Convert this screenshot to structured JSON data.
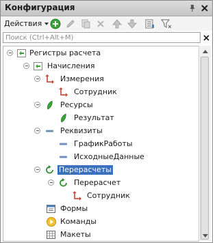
{
  "window": {
    "title": "Конфигурация",
    "pin_icon": "pin-icon",
    "close_icon": "close-icon"
  },
  "toolbar": {
    "actions_label": "Действия",
    "icons": [
      "add-icon",
      "edit-icon",
      "copy-icon",
      "delete-icon",
      "move-up-icon",
      "move-down-icon",
      "list-icon",
      "filter-icon"
    ],
    "accent": "#3aa33a"
  },
  "search": {
    "placeholder": "Поиск (Ctrl+Alt+M)",
    "value": ""
  },
  "tree": {
    "selected_color": "#3c6fbd",
    "items": [
      {
        "label": "Регистры расчета",
        "icon": "calc-register-icon",
        "expanded": true,
        "selected": false
      },
      {
        "label": "Начисления",
        "icon": "calc-register-icon",
        "expanded": true,
        "selected": false
      },
      {
        "label": "Измерения",
        "icon": "dimension-icon",
        "expanded": true,
        "selected": false
      },
      {
        "label": "Сотрудник",
        "icon": "dimension-icon",
        "expanded": false,
        "selected": false
      },
      {
        "label": "Ресурсы",
        "icon": "resource-icon",
        "expanded": true,
        "selected": false
      },
      {
        "label": "Результат",
        "icon": "resource-icon",
        "expanded": false,
        "selected": false
      },
      {
        "label": "Реквизиты",
        "icon": "attribute-icon",
        "expanded": true,
        "selected": false
      },
      {
        "label": "ГрафикРаботы",
        "icon": "attribute-icon",
        "expanded": false,
        "selected": false
      },
      {
        "label": "ИсходныеДанные",
        "icon": "attribute-icon",
        "expanded": false,
        "selected": false
      },
      {
        "label": "Перерасчеты",
        "icon": "recalculation-icon",
        "expanded": true,
        "selected": true
      },
      {
        "label": "Перерасчет",
        "icon": "recalculation-icon",
        "expanded": true,
        "selected": false
      },
      {
        "label": "Сотрудник",
        "icon": "dimension-icon",
        "expanded": false,
        "selected": false
      },
      {
        "label": "Формы",
        "icon": "form-icon",
        "expanded": false,
        "selected": false
      },
      {
        "label": "Команды",
        "icon": "command-icon",
        "expanded": false,
        "selected": false
      },
      {
        "label": "Макеты",
        "icon": "template-icon",
        "expanded": false,
        "selected": false
      }
    ]
  }
}
